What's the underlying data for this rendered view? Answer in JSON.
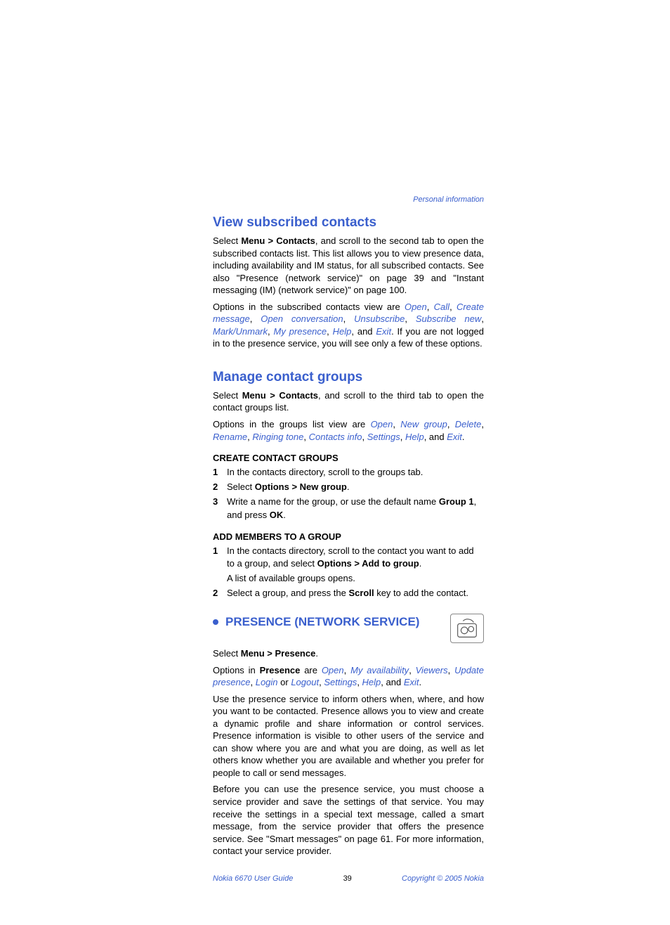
{
  "header_link": "Personal information",
  "s1": {
    "title": "View subscribed contacts",
    "p1a": "Select ",
    "p1b": "Menu > Contacts",
    "p1c": ", and scroll to the second tab to open the subscribed contacts list. This list allows you to view presence data, including availability and IM status, for all subscribed contacts. See also \"Presence (network service)\" on page 39 and \"Instant messaging (IM) (network service)\" on page 100.",
    "p2a": "Options in the subscribed contacts view are ",
    "o1": "Open",
    "o2": "Call",
    "o3": "Create message",
    "o4": "Open conversation",
    "o5": "Unsubscribe",
    "o6": "Subscribe new",
    "o7": "Mark/Unmark",
    "o8": "My presence",
    "o9": "Help",
    "p2b": ", and ",
    "o10": "Exit",
    "p2c": ". If you are not logged in to the presence service, you will see only a few of these options."
  },
  "s2": {
    "title": "Manage contact groups",
    "p1a": "Select ",
    "p1b": "Menu > Contacts",
    "p1c": ", and scroll to the third tab to open the contact groups list.",
    "p2a": "Options in the groups list view are ",
    "g1": "Open",
    "g2": "New group",
    "g3": "Delete",
    "g4": "Rename",
    "g5": "Ringing tone",
    "g6": "Contacts info",
    "g7": "Settings",
    "g8": "Help",
    "p2b": ", and ",
    "g9": "Exit",
    "p2c": ".",
    "sub1": "CREATE CONTACT GROUPS",
    "c1": "In the contacts directory, scroll to the groups tab.",
    "c2a": "Select ",
    "c2b": "Options > New group",
    "c2c": ".",
    "c3a": "Write a name for the group, or use the default name ",
    "c3b": "Group 1",
    "c3c": ", and press ",
    "c3d": "OK",
    "c3e": ".",
    "sub2": "ADD MEMBERS TO A GROUP",
    "a1a": "In the contacts directory, scroll to the contact you want to add to a group, and select ",
    "a1b": "Options > Add to group",
    "a1c": ".",
    "a1d": "A list of available groups opens.",
    "a2a": "Select a group, and press the ",
    "a2b": "Scroll",
    "a2c": " key to add the contact."
  },
  "s3": {
    "title": "PRESENCE (NETWORK SERVICE)",
    "p1a": "Select ",
    "p1b": "Menu > Presence",
    "p1c": ".",
    "p2a": "Options in ",
    "p2b": "Presence",
    "p2c": " are ",
    "po1": "Open",
    "po2": "My availability",
    "po3": "Viewers",
    "po4": "Update presence",
    "po5": "Login",
    "or": " or ",
    "po6": "Logout",
    "po7": "Settings",
    "po8": "Help",
    "p2d": ", and ",
    "po9": "Exit",
    "p2e": ".",
    "p3": "Use the presence service to inform others when, where, and how you want to be contacted. Presence allows you to view and create a dynamic profile and share information or control services. Presence information is visible to other users of the service and can show where you are and what you are doing, as well as let others know whether you are available and whether you prefer for people to call or send messages.",
    "p4": "Before you can use the presence service, you must choose a service provider and save the settings of that service. You may receive the settings in a special text message, called a smart message, from the service provider that offers the presence service. See \"Smart messages\" on page 61. For more information, contact your service provider."
  },
  "footer": {
    "left": "Nokia 6670 User Guide",
    "mid": "39",
    "right": "Copyright © 2005 Nokia"
  },
  "nums": {
    "n1": "1",
    "n2": "2",
    "n3": "3"
  }
}
